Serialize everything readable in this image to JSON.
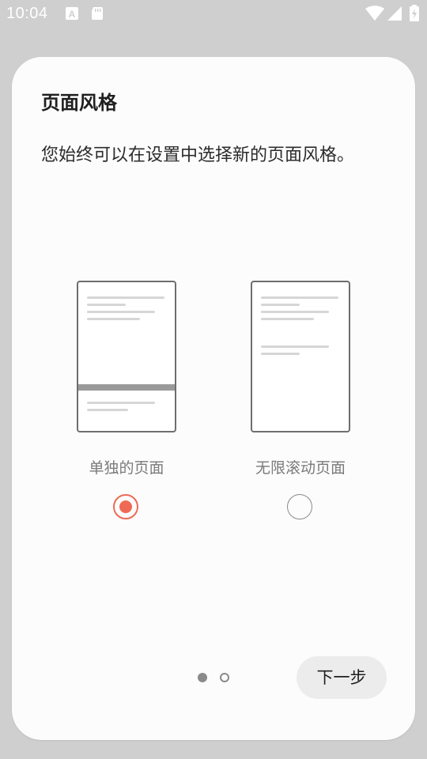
{
  "status_bar": {
    "time": "10:04",
    "icons_left": [
      "font-a-icon",
      "sd-card-icon"
    ],
    "icons_right": [
      "wifi-icon",
      "signal-icon",
      "battery-charging-icon"
    ]
  },
  "dialog": {
    "title": "页面风格",
    "description": "您始终可以在设置中选择新的页面风格。",
    "options": [
      {
        "label": "单独的页面",
        "selected": true,
        "icon": "single-page-icon"
      },
      {
        "label": "无限滚动页面",
        "selected": false,
        "icon": "infinite-scroll-page-icon"
      }
    ],
    "pager": {
      "current": 1,
      "total": 2
    },
    "next_label": "下一步"
  },
  "colors": {
    "accent": "#ee6a55",
    "background": "#cfcfcf",
    "card": "#fcfcfc",
    "button": "#ececec"
  }
}
